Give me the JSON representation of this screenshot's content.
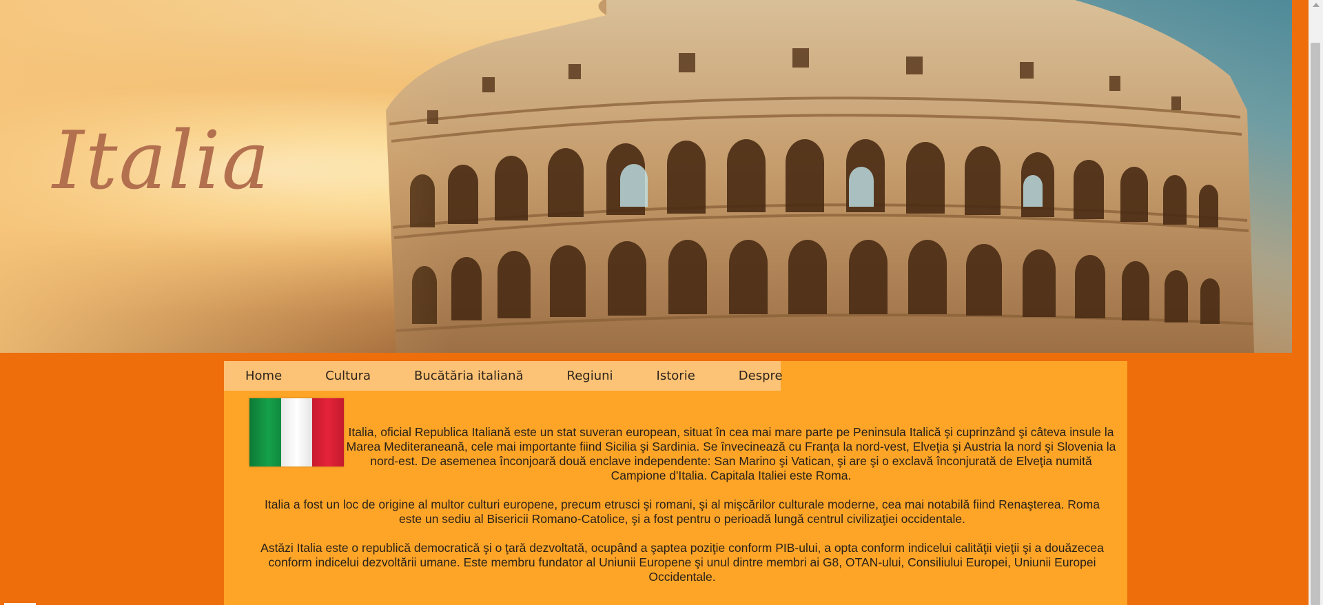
{
  "banner": {
    "title": "Italia"
  },
  "nav": {
    "items": [
      "Home",
      "Cultura",
      "Bucătăria italiană",
      "Regiuni",
      "Istorie",
      "Despre"
    ]
  },
  "article": {
    "paragraphs": [
      "Italia, oficial Republica Italiană este un stat suveran european, situat în cea mai mare parte pe Peninsula Italică şi cuprinzând şi câteva insule la Marea Mediteraneană, cele mai importante fiind Sicilia şi Sardinia. Se învecinează cu Franţa la nord-vest, Elveţia şi Austria la nord şi Slovenia la nord-est. De asemenea înconjoară două enclave independente: San Marino şi Vatican, şi are şi o exclavă înconjurată de Elveţia numită Campione d'Italia. Capitala Italiei este Roma.",
      "Italia a fost un loc de origine al multor culturi europene, precum etrusci şi romani, şi al mişcărilor culturale moderne, cea mai notabilă fiind Renaşterea. Roma este un sediu al Bisericii Romano-Catolice, şi a fost pentru o perioadă lungă centrul civilizaţiei occidentale.",
      "Astăzi Italia este o republică democratică şi o ţară dezvoltată, ocupând a şaptea poziţie conform PIB-ului, a opta conform indicelui calităţii vieţii şi a douăzecea conform indicelui dezvoltării umane. Este membru fundator al Uniunii Europene şi unul dintre membri ai G8, OTAN-ului, Consiliului Europei, Uniunii Europei Occidentale."
    ]
  },
  "colors": {
    "page_background": "#ee6e0c",
    "content_background": "#fea528",
    "nav_background": "#fcc276",
    "title_color": "#b3704f",
    "flag": [
      "#15a04a",
      "#ffffff",
      "#e4233a"
    ]
  },
  "icons": {
    "flag": "italy-flag-icon",
    "scroll_up": "scroll-up-arrow-icon"
  }
}
